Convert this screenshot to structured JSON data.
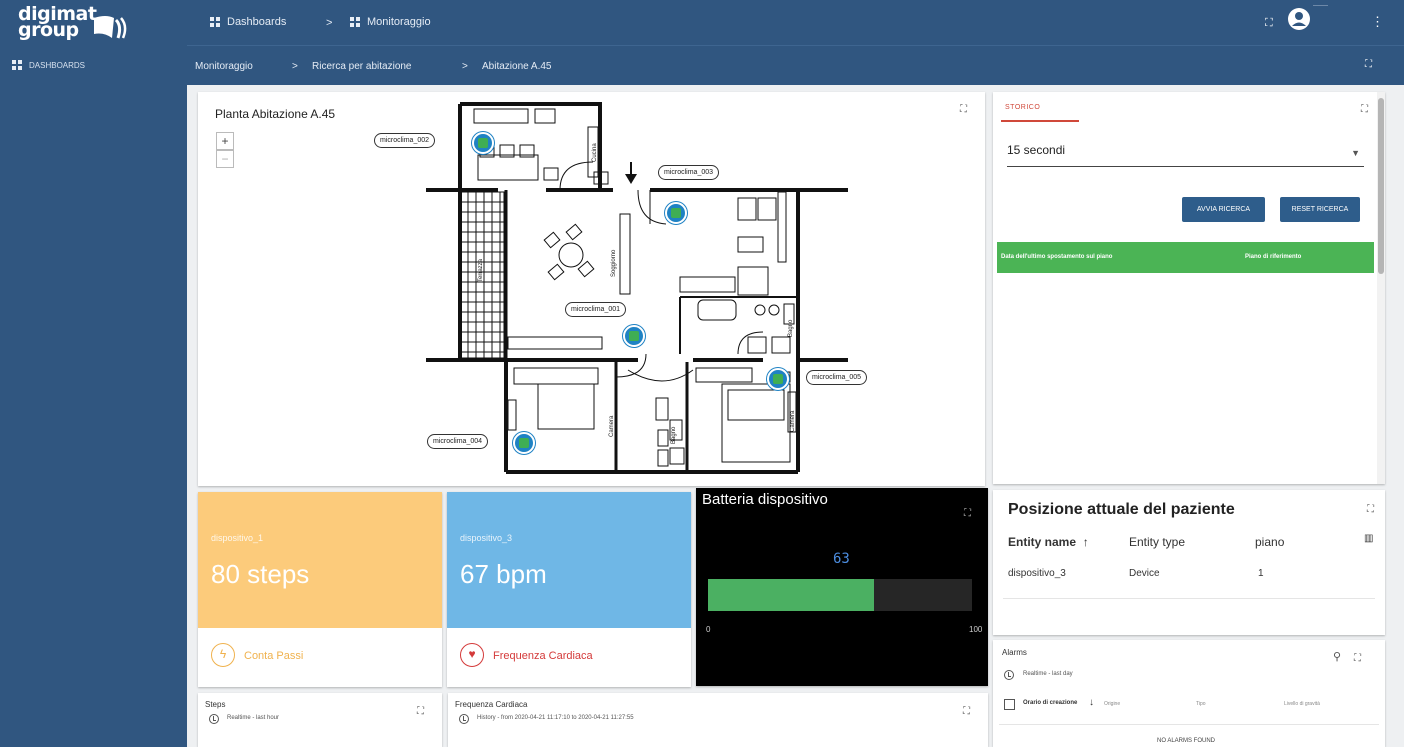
{
  "sidebar": {
    "logo_line1": "digimat",
    "logo_line2": "group",
    "nav_label": "DASHBOARDS"
  },
  "topbar": {
    "crumb1": "Dashboards",
    "crumb_sep": ">",
    "crumb2": "Monitoraggio",
    "user_label": "———"
  },
  "subbar": {
    "crumb1": "Monitoraggio",
    "crumb2": "Ricerca per abitazione",
    "crumb3": "Abitazione A.45",
    "sep": ">"
  },
  "plan": {
    "title": "Planta Abitazione A.45",
    "zoom_in": "+",
    "zoom_out": "−",
    "rooms": {
      "cucina": "Cucina",
      "terrazza": "Terrazza",
      "soggiorno": "Soggiorno",
      "bagno1": "Bagno",
      "camera1": "Camera",
      "camera2": "Camera",
      "bagno2": "Bagno"
    },
    "sensors": [
      {
        "label": "microclima_002"
      },
      {
        "label": "microclima_003"
      },
      {
        "label": "microclima_001"
      },
      {
        "label": "microclima_005"
      },
      {
        "label": "microclima_004"
      }
    ]
  },
  "storico": {
    "tab": "STORICO",
    "select_value": "15 secondi",
    "btn_start": "AVVIA RICERCA",
    "btn_reset": "RESET RICERCA",
    "col1": "Data dell'ultimo spostamento sul piano",
    "col2": "Piano di riferimento"
  },
  "tiles": {
    "steps": {
      "device": "dispositivo_1",
      "value": "80 steps",
      "label": "Conta Passi",
      "color": "#fccb7b"
    },
    "heart": {
      "device": "dispositivo_3",
      "value": "67 bpm",
      "label": "Frequenza Cardiaca",
      "color": "#6fb7e6"
    }
  },
  "battery": {
    "title": "Batteria dispositivo",
    "value": "63",
    "level": 63,
    "min": "0",
    "max": "100"
  },
  "position": {
    "title": "Posizione attuale del paziente",
    "col_name": "Entity name",
    "col_type": "Entity type",
    "col_floor": "piano",
    "row_name": "dispositivo_3",
    "row_type": "Device",
    "row_floor": "1"
  },
  "alarms": {
    "title": "Alarms",
    "mode": "Realtime - last day",
    "col_created": "Orario di creazione",
    "col_origin": "Origine",
    "col_type": "Tipo",
    "col_severity": "Livello di gravità",
    "empty": "NO ALARMS FOUND"
  },
  "steps_card": {
    "title": "Steps",
    "mode": "Realtime - last hour"
  },
  "freq_card": {
    "title": "Frequenza Cardiaca",
    "mode": "History - from 2020-04-21 11:17:10 to 2020-04-21 11:27:55"
  }
}
